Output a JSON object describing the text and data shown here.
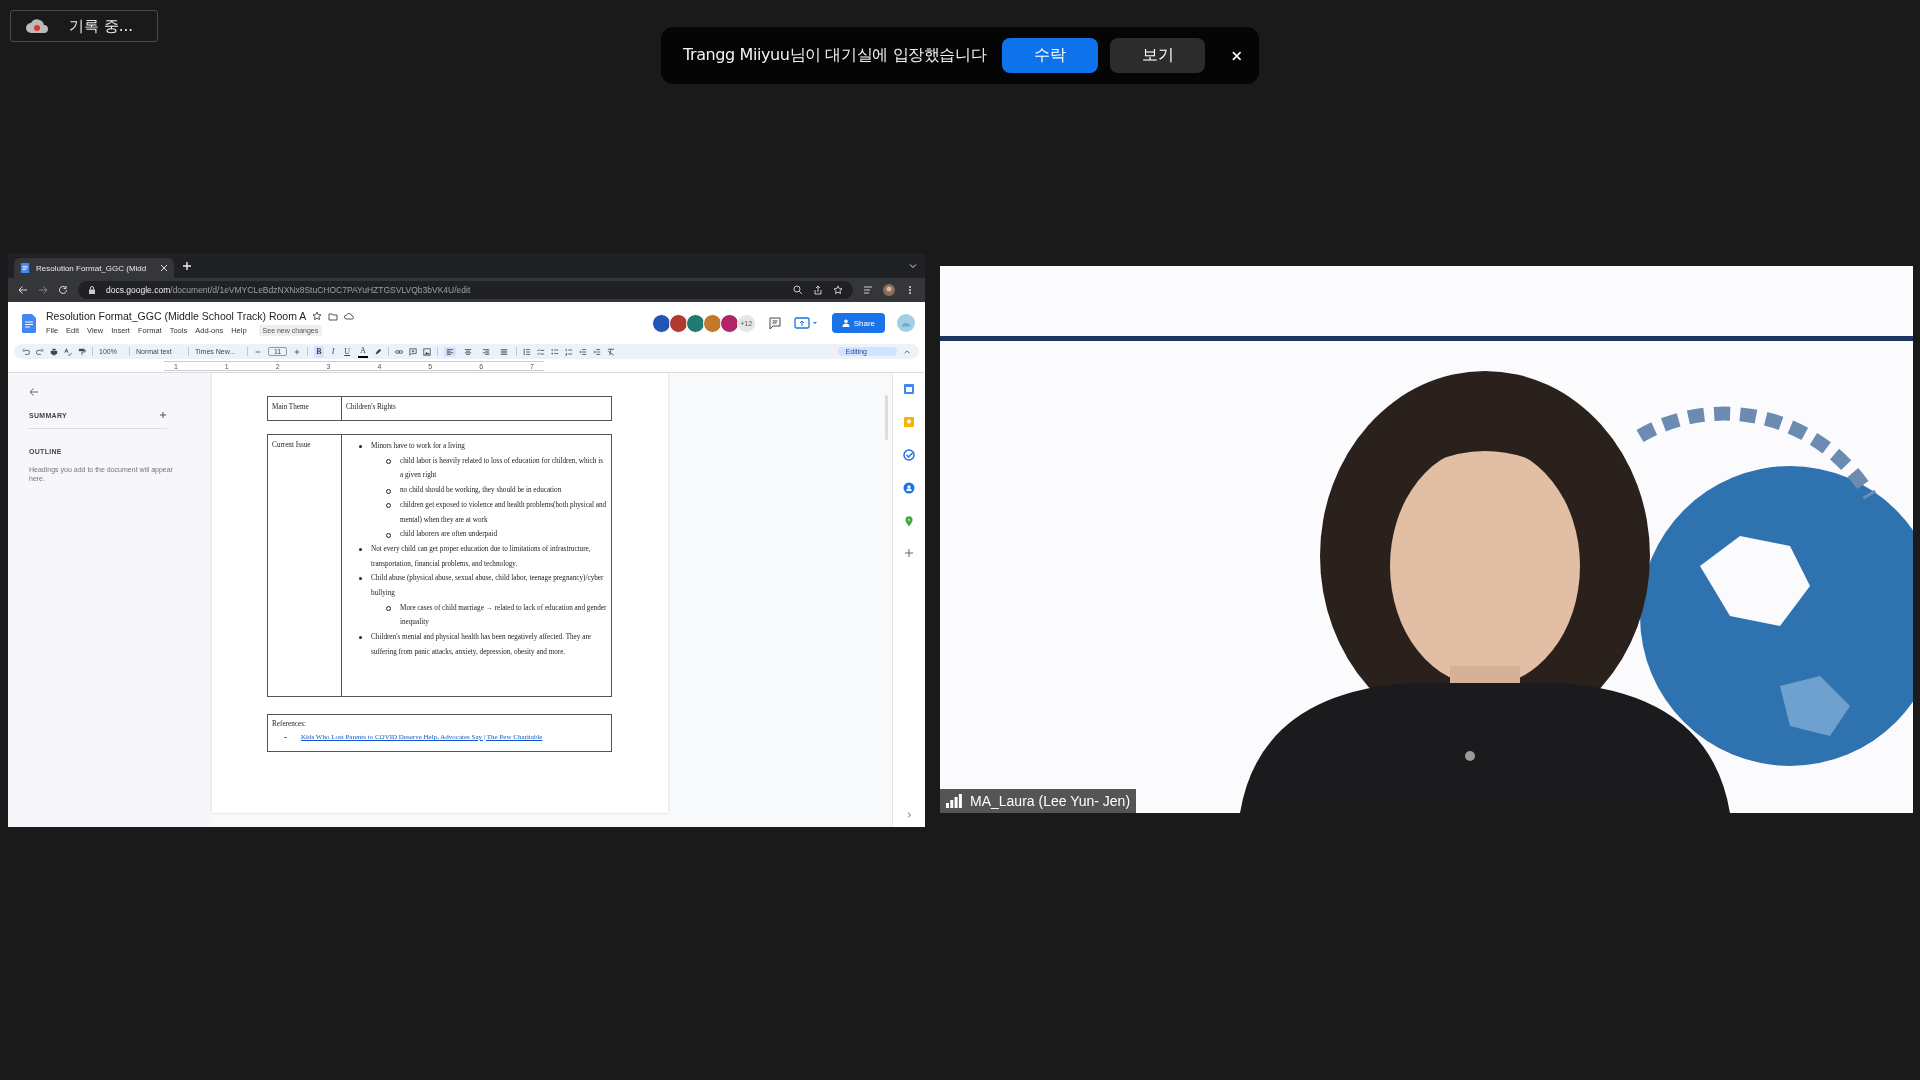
{
  "recording": {
    "label": "기록 중..."
  },
  "notification": {
    "message": "Trangg Miiyuu님이 대기실에 입장했습니다",
    "accept": "수락",
    "view": "보기"
  },
  "share": {
    "tab": {
      "title": "Resolution Format_GGC (Midd"
    },
    "address": {
      "domain": "docs.google.com",
      "path": "/document/d/1eVMYCLeBdzNXNx8StuCHOC7PAYuHZTGSVLVQb3bVK4U/edit"
    },
    "docs": {
      "title": "Resolution Format_GGC (Middle School Track) Room A",
      "menu": [
        "File",
        "Edit",
        "View",
        "Insert",
        "Format",
        "Tools",
        "Add-ons",
        "Help"
      ],
      "see_new_changes": "See new changes",
      "collaborators": [
        {
          "color": "#2454b8"
        },
        {
          "color": "#b03a2e"
        },
        {
          "color": "#1f7a74"
        },
        {
          "color": "#c07a2a"
        },
        {
          "color": "#b0246a"
        }
      ],
      "more_collaborators": "+12",
      "share": "Share",
      "toolbar": {
        "zoom": "100%",
        "style": "Normal text",
        "font": "Times New...",
        "font_size": "11",
        "format_buttons": [
          {
            "label": "B",
            "selected": true
          },
          {
            "label": "I",
            "selected": false
          },
          {
            "label": "U",
            "selected": false
          }
        ],
        "text_color": "A",
        "alignments": [
          {
            "selected": true
          },
          {
            "selected": false
          },
          {
            "selected": false
          },
          {
            "selected": false
          }
        ],
        "mode": "Editing"
      },
      "ruler": [
        "1",
        "1",
        "2",
        "3",
        "4",
        "5",
        "6",
        "7"
      ],
      "outline": {
        "summary": "SUMMARY",
        "outline": "OUTLINE",
        "hint": "Headings you add to the document will appear here."
      },
      "document": {
        "theme_label": "Main Theme",
        "theme": "Children's Rights",
        "issue_label": "Current Issue",
        "issues": [
          {
            "text": "Minors have to work for a living",
            "children": [
              {
                "text": "child labor is heavily related to loss of education for children, which is a given right"
              },
              {
                "text": "no child should be working, they should be in education"
              },
              {
                "text": "children get exposed to violence and health problems(both physical and mental) when they are at work"
              },
              {
                "text": "child laborers are often underpaid"
              }
            ]
          },
          {
            "text": "Not every child can get proper education due to limitations of infrastructure, transportation, financial problems, and technology."
          },
          {
            "text": "Child abuse (physical abuse, sexual abuse, child labor, teenage pregnancy)/cyber bullying",
            "children": [
              {
                "text": "More cases of child marriage → related to lack of education and gender inequality"
              }
            ]
          },
          {
            "text": "Children's mental and physical health has been negatively affected. They are suffering from panic attacks, anxiety, depression, obesity and more."
          }
        ],
        "references_label": "References:",
        "references": [
          "Kids Who Lost Parents to COVID Deserve Help, Advocates Say | The Pew Charitable"
        ]
      }
    }
  },
  "video": {
    "kind": "picture",
    "name": "MA_Laura (Lee Yun- Jen)"
  }
}
